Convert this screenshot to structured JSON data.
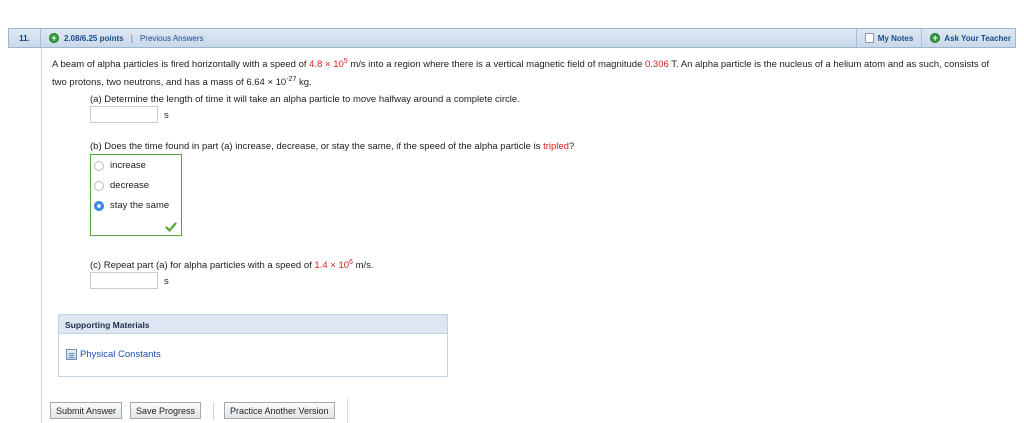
{
  "header": {
    "question_number": "11.",
    "points": "2.08/6.25 points",
    "separator": "|",
    "previous_answers": "Previous Answers",
    "my_notes": "My Notes",
    "ask_teacher": "Ask Your Teacher"
  },
  "stem": {
    "t1": "A beam of alpha particles is fired horizontally with a speed of ",
    "speed_mantissa": "4.8",
    "speed_times": " × 10",
    "speed_exp": "5",
    "t2": " m/s into a region where there is a vertical magnetic field of magnitude ",
    "field_value": "0.306",
    "t3": " T. An alpha particle is the nucleus of a helium atom and as such, consists of two protons, two neutrons, and has a mass of 6.64 × 10",
    "mass_exp": "-27",
    "t4": " kg."
  },
  "part_a": {
    "question": "(a) Determine the length of time it will take an alpha particle to move halfway around a complete circle.",
    "unit": "s",
    "value": ""
  },
  "part_b": {
    "q1": "(b) Does the time found in part (a) increase, decrease, or stay the same, if the speed of the alpha particle is ",
    "q_red": "tripled",
    "q2": "?",
    "options": [
      "increase",
      "decrease",
      "stay the same"
    ],
    "selected": "stay the same",
    "status_color": "#55a636"
  },
  "part_c": {
    "q1": "(c) Repeat part (a) for alpha particles with a speed of ",
    "speed_mantissa": "1.4",
    "speed_times": " × 10",
    "speed_exp": "6",
    "q2": " m/s.",
    "unit": "s",
    "value": ""
  },
  "support": {
    "title": "Supporting Materials",
    "link": "Physical Constants"
  },
  "buttons": {
    "submit": "Submit Answer",
    "save": "Save Progress",
    "practice": "Practice Another Version"
  }
}
